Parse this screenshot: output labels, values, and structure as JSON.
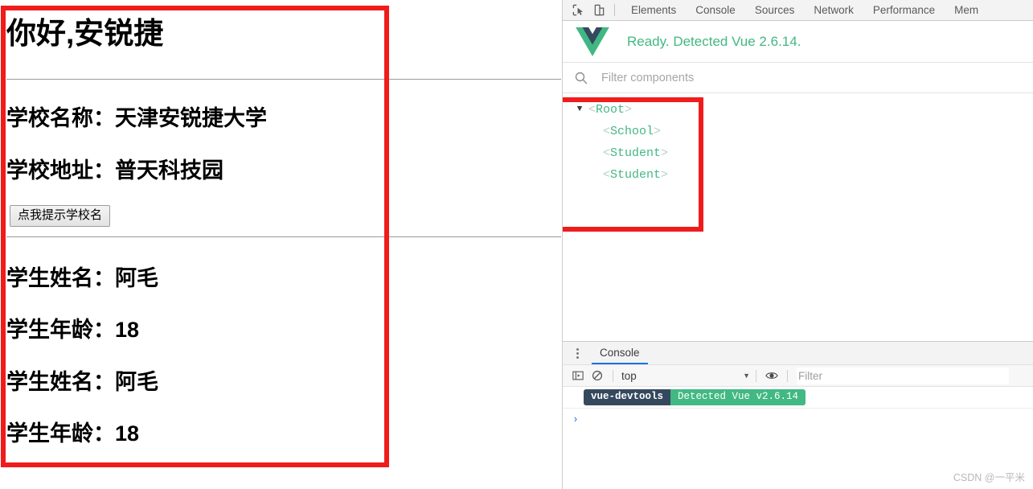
{
  "page": {
    "heading": "你好,安锐捷",
    "school": {
      "name_label": "学校名称：",
      "name_value": "天津安锐捷大学",
      "addr_label": "学校地址：",
      "addr_value": "普天科技园",
      "button_label": "点我提示学校名"
    },
    "students": [
      {
        "name_label": "学生姓名：",
        "name_value": "阿毛",
        "age_label": "学生年龄：",
        "age_value": "18"
      },
      {
        "name_label": "学生姓名：",
        "name_value": "阿毛",
        "age_label": "学生年龄：",
        "age_value": "18"
      }
    ]
  },
  "devtools": {
    "tabs": [
      {
        "label": "Elements"
      },
      {
        "label": "Console"
      },
      {
        "label": "Sources"
      },
      {
        "label": "Network"
      },
      {
        "label": "Performance"
      },
      {
        "label": "Mem"
      }
    ],
    "icons": {
      "inspect": "inspect-element-icon",
      "device": "device-toolbar-icon"
    },
    "vue_panel": {
      "status_text": "Ready. Detected Vue 2.6.14.",
      "logo_name": "vue-logo",
      "filter_placeholder": "Filter components",
      "tree": [
        {
          "caret": "▼",
          "open": "<",
          "name": "Root",
          "close": ">",
          "depth": 0
        },
        {
          "caret": "",
          "open": "<",
          "name": "School",
          "close": ">",
          "depth": 1
        },
        {
          "caret": "",
          "open": "<",
          "name": "Student",
          "close": ">",
          "depth": 1
        },
        {
          "caret": "",
          "open": "<",
          "name": "Student",
          "close": ">",
          "depth": 1
        }
      ]
    },
    "drawer": {
      "tab_label": "Console",
      "context_value": "top",
      "context_caret": "▼",
      "filter_placeholder": "Filter",
      "messages": [
        {
          "source_badge": "vue-devtools",
          "text_badge": "Detected Vue v2.6.14"
        }
      ],
      "prompt_caret": "›"
    }
  },
  "watermark": "CSDN @一平米",
  "colors": {
    "highlight_red": "#f01c1c",
    "vue_green": "#42b883",
    "vue_navy": "#35495e",
    "tab_active_blue": "#1a73e8"
  }
}
